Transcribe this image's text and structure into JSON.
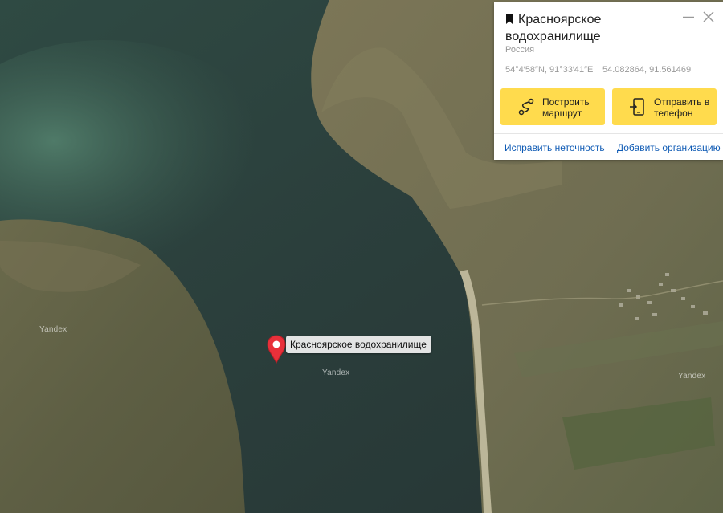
{
  "place_card": {
    "title": "Красноярское водохранилище",
    "subtitle": "Россия",
    "coords_dms": "54°4′58″N, 91°33′41″E",
    "coords_decimal": "54.082864, 91.561469",
    "route_button": "Построить маршрут",
    "phone_button": "Отправить в телефон",
    "fix_link": "Исправить неточность",
    "add_org_link": "Добавить организацию",
    "icons": [
      "bookmark-icon",
      "minimize-icon",
      "close-icon",
      "route-icon",
      "phone-icon"
    ]
  },
  "map": {
    "marker_label": "Красноярское водохранилище",
    "watermarks": [
      "Yandex",
      "Yandex",
      "Yandex"
    ],
    "marker_color": "#e8303a",
    "button_color": "#ffdb4d",
    "link_color": "#0f5bb5"
  }
}
